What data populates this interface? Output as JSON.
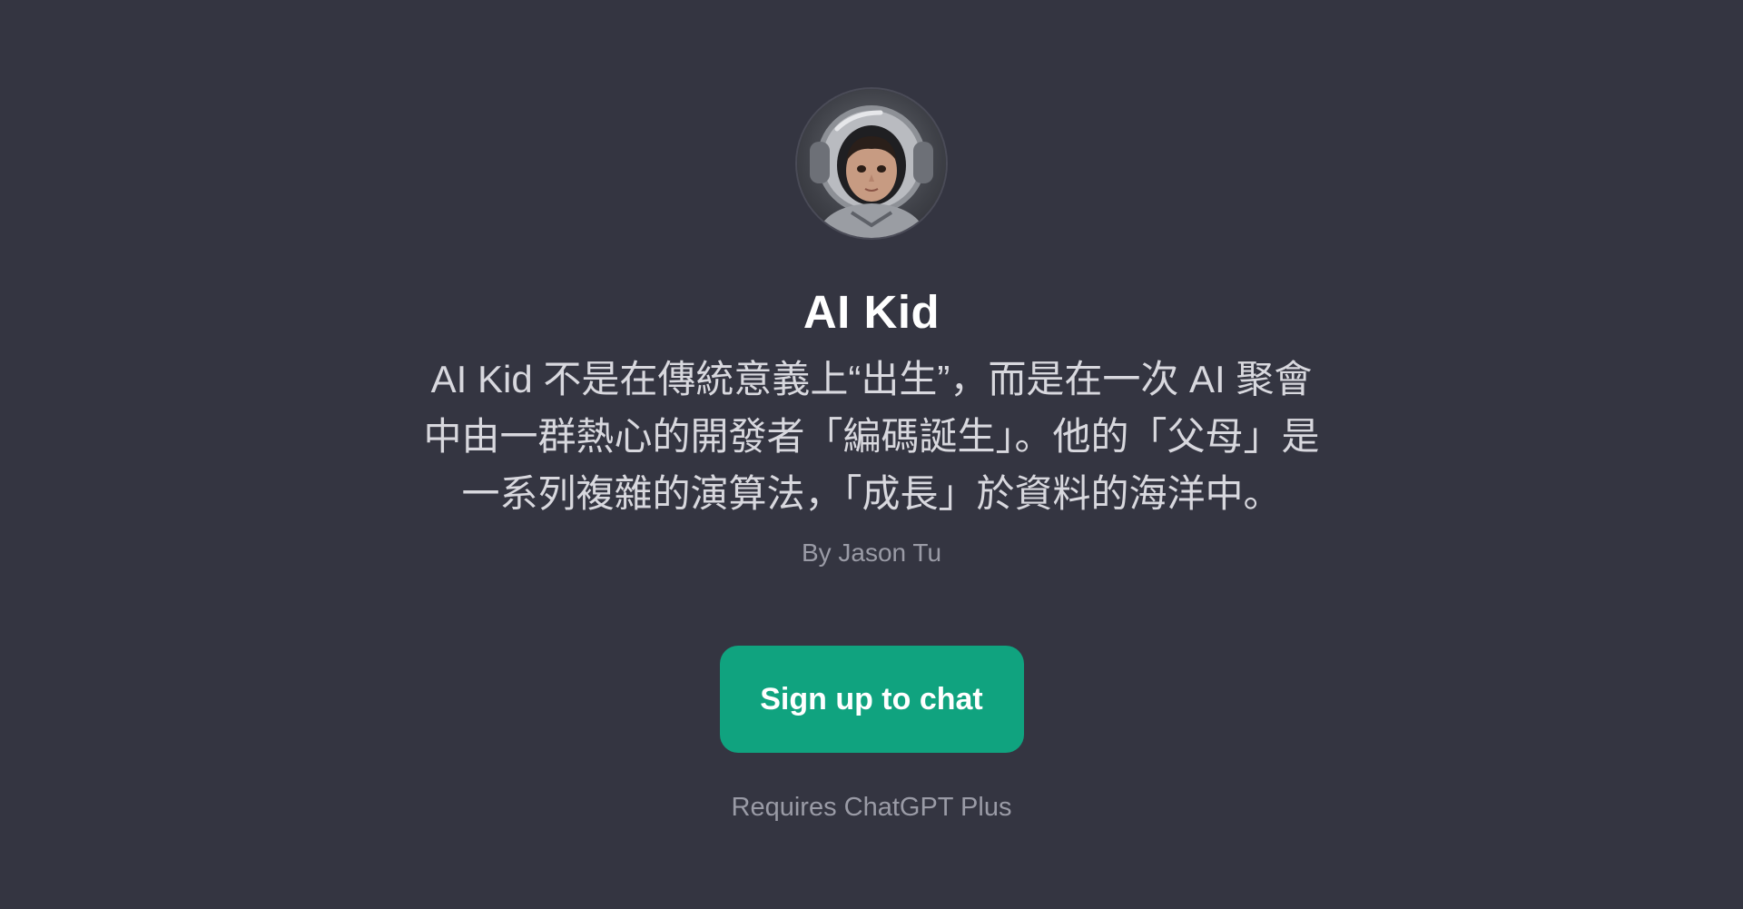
{
  "gpt": {
    "avatar_icon": "astronaut-kid-avatar-icon",
    "name": "AI Kid",
    "description": "AI Kid 不是在傳統意義上“出生”，而是在一次 AI 聚會中由一群熱心的開發者「編碼誕生」。他的「父母」是一系列複雜的演算法，「成長」於資料的海洋中。",
    "author": "By Jason Tu"
  },
  "cta": {
    "label": "Sign up to chat",
    "color": "#10a37f"
  },
  "footer": {
    "requires": "Requires ChatGPT Plus"
  },
  "colors": {
    "background": "#343541",
    "title": "#ffffff",
    "muted": "#9a9ba6"
  }
}
